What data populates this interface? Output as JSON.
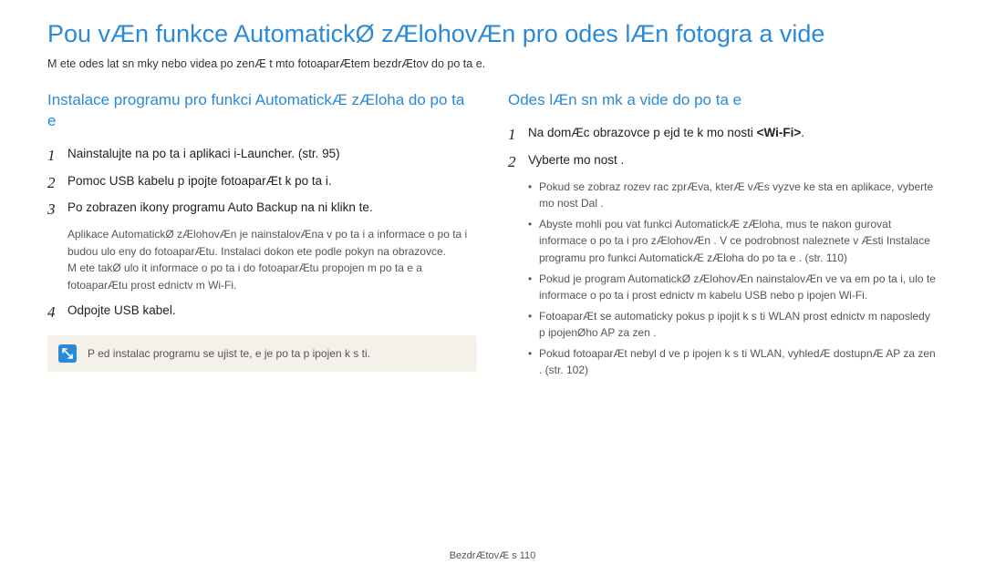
{
  "title": "Pou vÆn funkce AutomatickØ zÆlohovÆn pro odes lÆn fotogra a vide",
  "intro": "M ete odes lat sn mky nebo videa po zenÆ t mto fotoaparÆtem bezdrÆtov do po ta e.",
  "left": {
    "heading": "Instalace programu pro funkci AutomatickÆ zÆloha do po ta e",
    "steps": [
      {
        "num": "1",
        "text": "Nainstalujte na po ta i aplikaci i-Launcher. (str. 95)"
      },
      {
        "num": "2",
        "text": "Pomoc USB kabelu p ipojte fotoaparÆt k po ta i."
      },
      {
        "num": "3",
        "text": "Po zobrazen ikony programu Auto Backup na ni klikn te.",
        "note": "Aplikace AutomatickØ zÆlohovÆn je nainstalovÆna v po ta i a informace o po ta i budou ulo eny do fotoaparÆtu. Instalaci dokon ete podle pokyn na obrazovce.\nM ete takØ ulo it informace o po ta i do fotoaparÆtu propojen m po ta e a fotoaparÆtu prost ednictv m Wi-Fi."
      },
      {
        "num": "4",
        "text": "Odpojte USB kabel."
      }
    ],
    "notebox": "P ed instalac programu se ujist te, e je po ta p ipojen k s ti."
  },
  "right": {
    "heading": "Odes lÆn sn mk a vide do po ta e",
    "steps": [
      {
        "num": "1",
        "text_before": "Na domÆc obrazovce p ejd te k mo nosti",
        "text_bold": "<Wi-Fi>",
        "text_after": "."
      },
      {
        "num": "2",
        "text": "Vyberte mo nost     .",
        "bullets": [
          "Pokud se zobraz rozev rac zprÆva, kterÆ vÆs vyzve ke sta en aplikace, vyberte mo nost Dal .",
          "Abyste mohli pou vat funkci AutomatickÆ zÆloha, mus te nakon gurovat informace o po ta i pro zÆlohovÆn . V ce podrobnost naleznete v Æsti Instalace programu pro funkci AutomatickÆ zÆloha do po ta e . (str. 110)",
          "Pokud je program AutomatickØ zÆlohovÆn nainstalovÆn ve va em po ta i, ulo te informace o po ta i prost ednictv m kabelu USB nebo p ipojen Wi-Fi.",
          "FotoaparÆt se automaticky pokus p ipojit k s ti WLAN prost ednictv m naposledy p ipojenØho AP za zen .",
          "Pokud fotoaparÆt nebyl d ve p ipojen k s ti WLAN, vyhledÆ dostupnÆ AP za zen . (str. 102)"
        ]
      }
    ]
  },
  "footer": "BezdrÆtovÆ s 110"
}
